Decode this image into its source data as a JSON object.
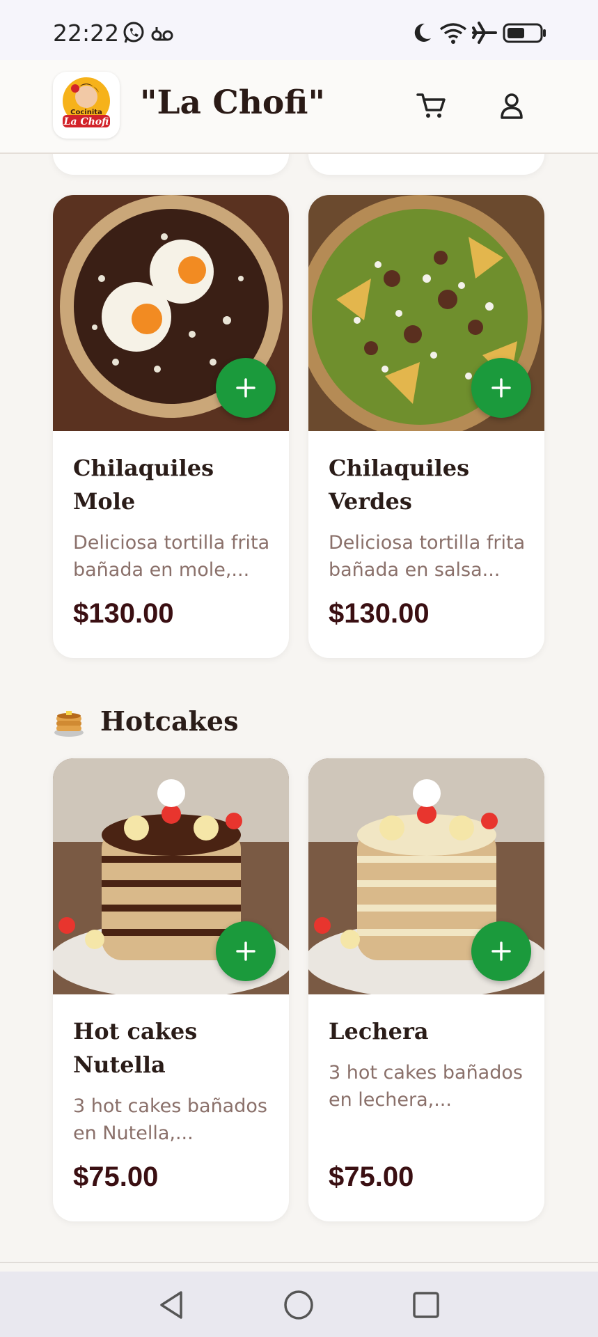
{
  "status_bar": {
    "time": "22:22",
    "icons": [
      "whatsapp-icon",
      "voicemail-icon",
      "moon-icon",
      "wifi-icon",
      "airplane-icon",
      "battery-icon"
    ]
  },
  "header": {
    "brand": "\"La Chofi\"",
    "logo_text_top": "Cocinita",
    "logo_text_bottom": "La Chofi",
    "icons": [
      "cart-icon",
      "user-icon"
    ]
  },
  "colors": {
    "add_button": "#1b9a3c",
    "price": "#3a0f12",
    "background": "#f7f5f2"
  },
  "sections": [
    {
      "items": [
        {
          "title": "Chilaquiles Mole",
          "description": "Deliciosa tortilla frita bañada en mole,...",
          "price": "$130.00"
        },
        {
          "title": "Chilaquiles Verdes",
          "description": "Deliciosa tortilla frita bañada en salsa...",
          "price": "$130.00"
        }
      ]
    },
    {
      "title": "Hotcakes",
      "emoji": "pancakes-icon",
      "items": [
        {
          "title": "Hot cakes Nutella",
          "description": "3 hot cakes bañados en Nutella,...",
          "price": "$75.00"
        },
        {
          "title": "Lechera",
          "description": "3 hot cakes bañados en lechera,...",
          "price": "$75.00"
        }
      ]
    }
  ],
  "nav_bar": {
    "icons": [
      "back-icon",
      "home-icon",
      "recents-icon"
    ]
  }
}
